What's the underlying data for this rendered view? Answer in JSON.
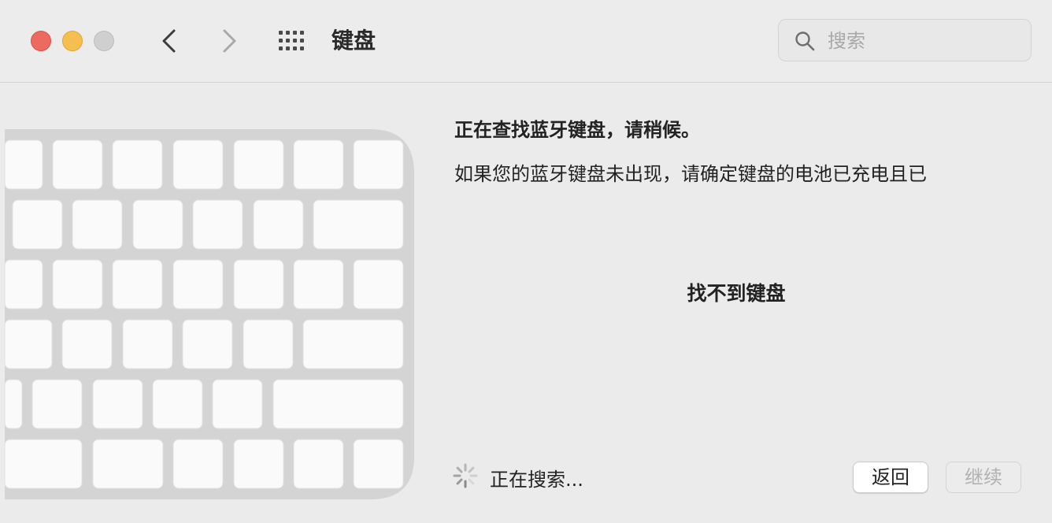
{
  "window": {
    "title": "键盘",
    "controls": [
      "close",
      "minimize",
      "zoom"
    ]
  },
  "toolbar": {
    "back_icon": "chevron-left-icon",
    "forward_icon": "chevron-right-icon",
    "grid_icon": "grid-icon",
    "search": {
      "placeholder": "搜索",
      "value": ""
    }
  },
  "content": {
    "heading": "正在查找蓝牙键盘，请稍候。",
    "description": "如果您的蓝牙键盘未出现，请确定键盘的电池已充电且已",
    "not_found": "找不到键盘",
    "status": "正在搜索..."
  },
  "buttons": {
    "back": "返回",
    "continue": "继续"
  },
  "colors": {
    "close": "#ed6a5e",
    "minimize": "#f5bf4f",
    "zoom": "#cfcfcf",
    "keyboard_frame": "#d4d4d4",
    "key": "#fafafa"
  }
}
